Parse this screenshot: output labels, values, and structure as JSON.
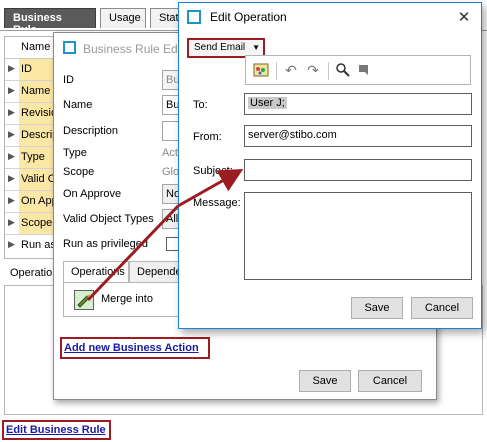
{
  "base_window": {
    "tabs": [
      {
        "label": "Business Rule",
        "active": true
      },
      {
        "label": "Usage",
        "active": false
      },
      {
        "label": "Stat",
        "active": false
      }
    ],
    "property_grid": {
      "header": "Name",
      "rows": [
        {
          "label": "ID",
          "highlighted": true
        },
        {
          "label": "Name",
          "highlighted": true
        },
        {
          "label": "Revisio",
          "highlighted": true
        },
        {
          "label": "Descrip",
          "highlighted": true
        },
        {
          "label": "Type",
          "highlighted": true
        },
        {
          "label": "Valid O",
          "highlighted": true
        },
        {
          "label": "On App",
          "highlighted": true
        },
        {
          "label": "Scope",
          "highlighted": true
        },
        {
          "label": "Run as",
          "highlighted": false
        }
      ]
    },
    "lower_tab": "Operation",
    "edit_rule_link": "Edit Business Rule"
  },
  "business_rule_editor": {
    "title": "Business Rule Edito",
    "fields": {
      "id_label": "ID",
      "id_value": "Bus",
      "name_label": "Name",
      "name_value": "Bus",
      "description_label": "Description",
      "type_label": "Type",
      "type_value": "Acti",
      "scope_label": "Scope",
      "scope_value": "Glo",
      "on_approve_label": "On Approve",
      "on_approve_value": "No",
      "valid_object_types_label": "Valid Object Types",
      "valid_object_types_value": "All",
      "run_as_privileged_label": "Run as privileged"
    },
    "tabs": [
      {
        "label": "Operations",
        "active": true
      },
      {
        "label": "Depende",
        "active": false
      }
    ],
    "operation": {
      "label": "Merge  into"
    },
    "add_action_link": "Add new Business Action",
    "save_label": "Save",
    "cancel_label": "Cancel"
  },
  "edit_operation": {
    "title": "Edit Operation",
    "operation_type": "Send Email",
    "toolbar_icons": [
      "insert-variable-icon",
      "undo-icon",
      "redo-icon",
      "find-icon",
      "replace-icon"
    ],
    "to_label": "To:",
    "to_value": "User J;",
    "from_label": "From:",
    "from_value": "server@stibo.com",
    "subject_label": "Subject:",
    "subject_value": "",
    "message_label": "Message:",
    "message_value": "",
    "save_label": "Save",
    "cancel_label": "Cancel"
  },
  "colors": {
    "highlight_box": "#9b1c22",
    "link": "#1a1aa8",
    "row_highlight": "#fbe7a6",
    "dialog_accent": "#1e95c9"
  }
}
